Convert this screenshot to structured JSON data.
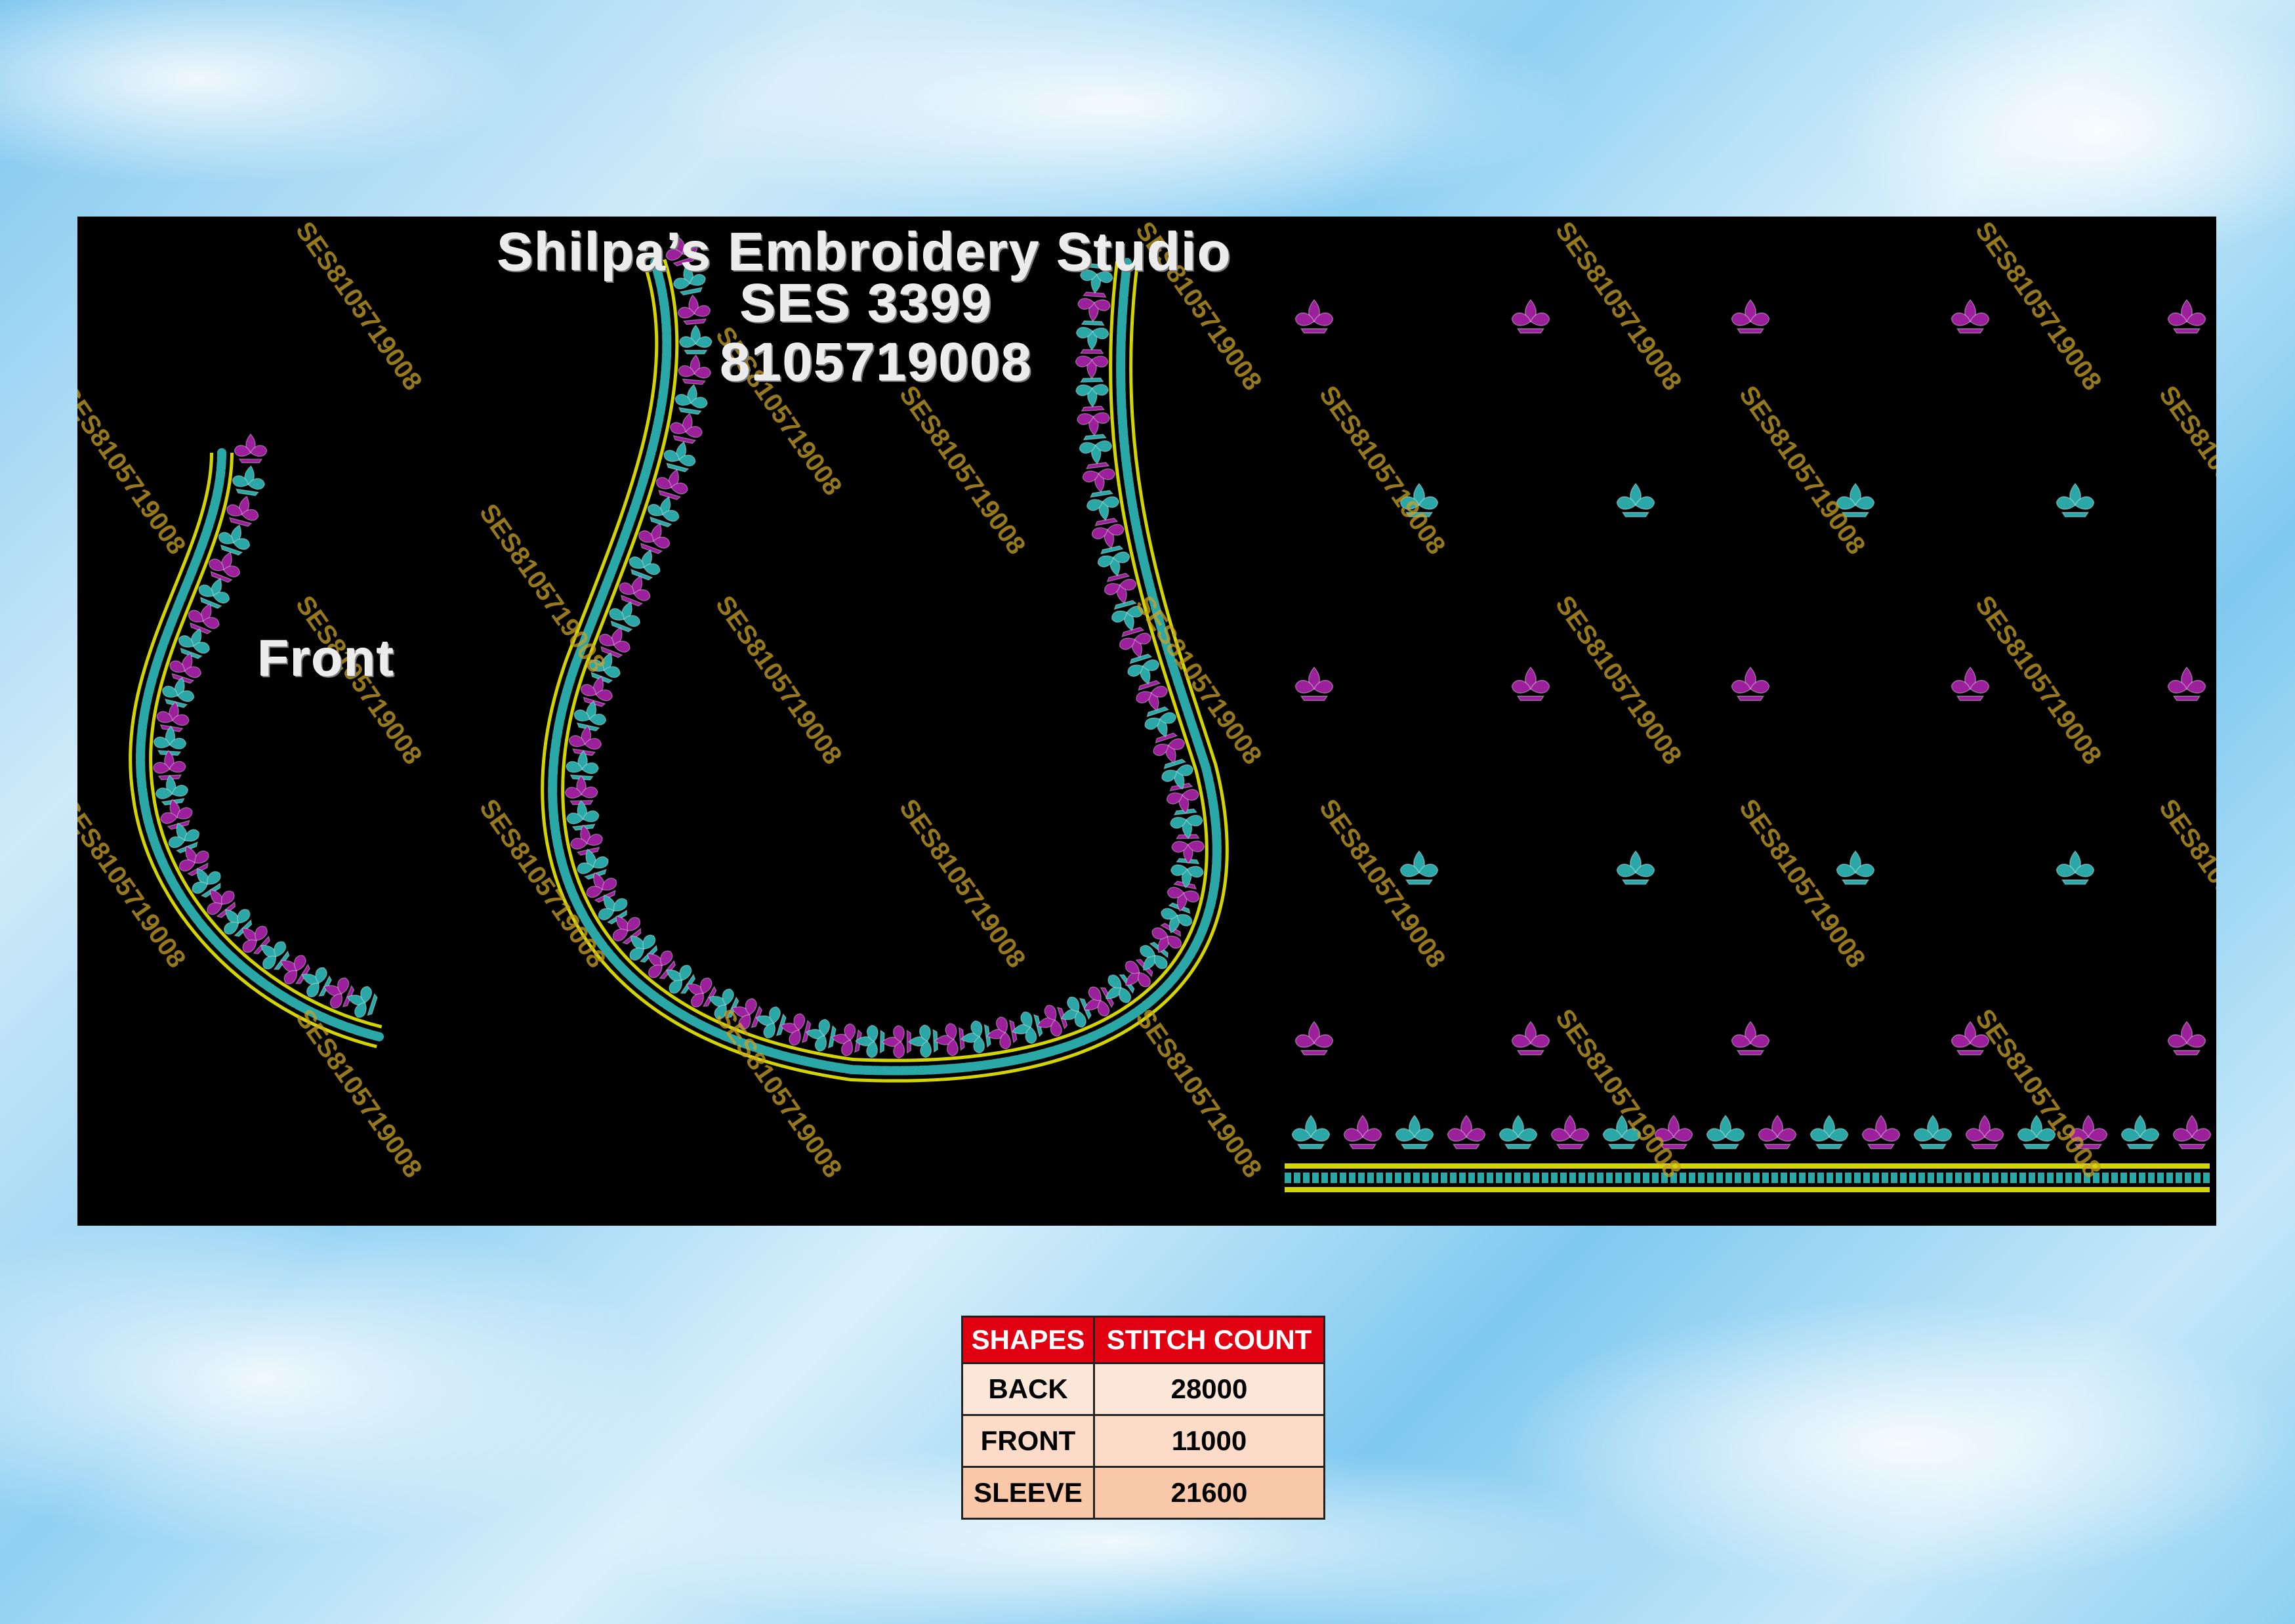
{
  "header": {
    "studio_name": "Shilpa’s Embroidery Studio",
    "design_code": "SES  3399",
    "phone": "8105719008"
  },
  "labels": {
    "front": "Front"
  },
  "watermark": "SES8105719008",
  "colors": {
    "magenta": "#9c1f9c",
    "teal": "#2aa8a8",
    "yellow": "#d4d400",
    "background": "#000000"
  },
  "table": {
    "headers": [
      "SHAPES",
      "STITCH COUNT"
    ],
    "rows": [
      {
        "shape": "BACK",
        "count": "28000"
      },
      {
        "shape": "FRONT",
        "count": "11000"
      },
      {
        "shape": "SLEEVE",
        "count": "21600"
      }
    ]
  }
}
